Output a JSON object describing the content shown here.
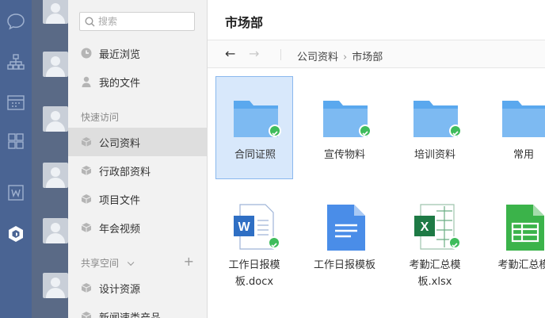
{
  "rail_icons": [
    "chat-icon",
    "org-icon",
    "calendar-icon",
    "apps-icon",
    "word-icon",
    "cloud-drive-icon"
  ],
  "sidebar": {
    "search_placeholder": "搜索",
    "top_items": [
      {
        "label": "最近浏览",
        "icon": "clock-icon"
      },
      {
        "label": "我的文件",
        "icon": "user-icon"
      }
    ],
    "quick_access_title": "快速访问",
    "quick_items": [
      {
        "label": "公司资料",
        "icon": "cube-icon",
        "active": true
      },
      {
        "label": "行政部资料",
        "icon": "cube-icon"
      },
      {
        "label": "项目文件",
        "icon": "cube-icon"
      },
      {
        "label": "年会视频",
        "icon": "cube-icon"
      }
    ],
    "shared_title": "共享空间",
    "shared_items": [
      {
        "label": "设计资源",
        "icon": "cube-icon"
      },
      {
        "label": "新闻速类产品",
        "icon": "cube-icon"
      }
    ]
  },
  "main": {
    "title": "市场部",
    "breadcrumb": [
      "公司资料",
      "市场部"
    ],
    "folders": [
      {
        "name": "合同证照",
        "selected": true,
        "synced": true
      },
      {
        "name": "宣传物料",
        "synced": true
      },
      {
        "name": "培训资料",
        "synced": true
      },
      {
        "name": "常用",
        "synced": false
      }
    ],
    "files": [
      {
        "name_line1": "工作日报模",
        "name_line2": "板.docx",
        "type": "word",
        "synced": true
      },
      {
        "name_line1": "工作日报模板",
        "name_line2": "",
        "type": "gdoc",
        "synced": false
      },
      {
        "name_line1": "考勤汇总模",
        "name_line2": "板.xlsx",
        "type": "excel",
        "synced": true
      },
      {
        "name_line1": "考勤汇总模",
        "name_line2": "",
        "type": "gsheet",
        "synced": false
      }
    ]
  },
  "colors": {
    "rail": "#4a6493",
    "folder": "#5aa8ee",
    "check": "#3ebc5b",
    "word": "#2f6fc4",
    "excel": "#1e7a45",
    "gdoc": "#4a8de8",
    "gsheet": "#3bb34a"
  }
}
